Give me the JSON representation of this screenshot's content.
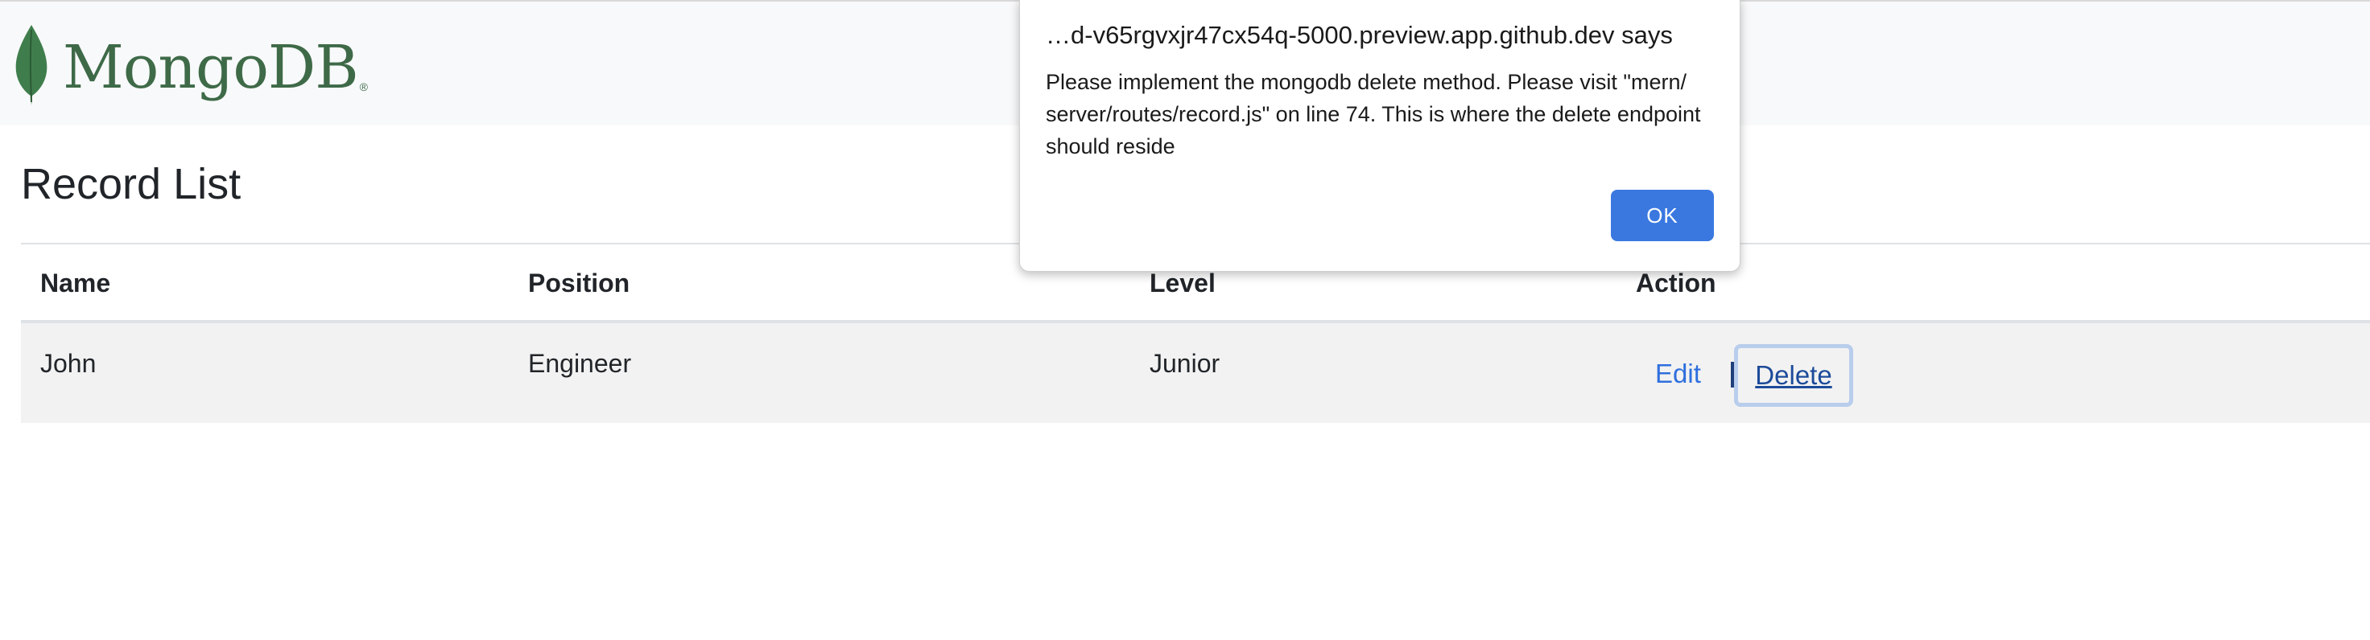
{
  "navbar": {
    "brand_text": "MongoDB",
    "brand_reg": "®",
    "brand_color": "#3e6a48"
  },
  "page": {
    "title": "Record List"
  },
  "table": {
    "headers": [
      "Name",
      "Position",
      "Level",
      "Action"
    ],
    "rows": [
      {
        "name": "John",
        "position": "Engineer",
        "level": "Junior",
        "edit_label": "Edit",
        "separator": "|",
        "delete_label": "Delete"
      }
    ]
  },
  "dialog": {
    "title": "…d-v65rgvxjr47cx54q-5000.preview.app.github.dev says",
    "message": "Please implement the mongodb delete method. Please visit \"mern/ server/routes/record.js\" on line 74. This is where the delete endpoint should reside",
    "ok_label": "OK",
    "ok_color": "#3a78e0"
  },
  "icons": {
    "brand_logo": "mongodb-leaf-icon"
  }
}
